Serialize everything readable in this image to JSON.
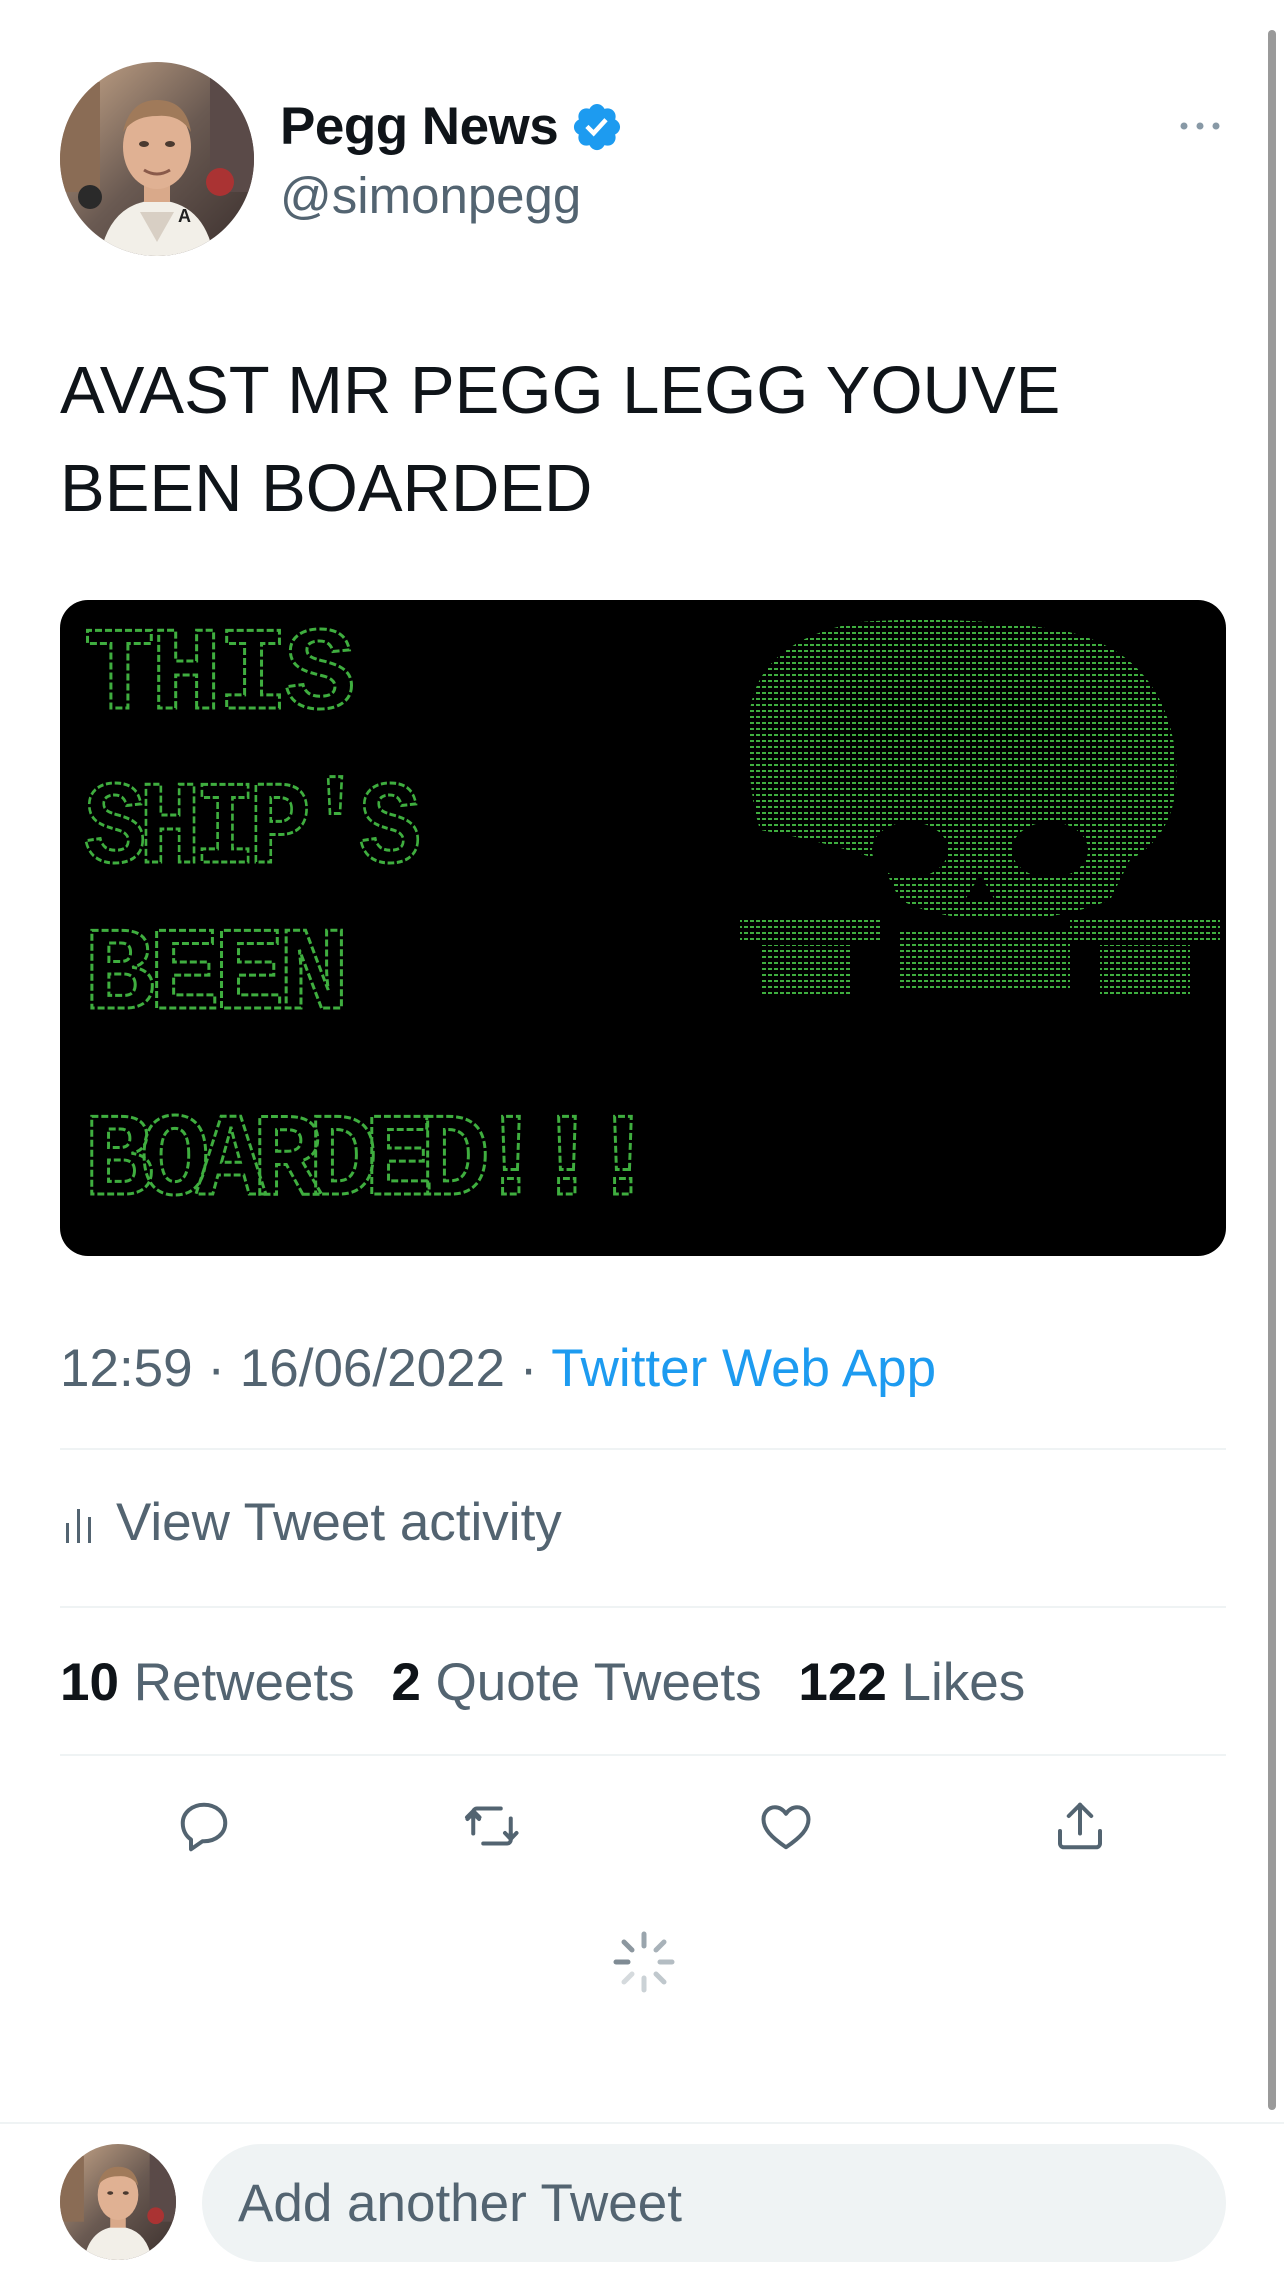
{
  "author": {
    "display_name": "Pegg News",
    "handle": "@simonpegg",
    "verified": true,
    "avatar_icon": "profile-photo"
  },
  "tweet": {
    "text": "AVAST MR PEGG LEGG YOUVE BEEN BOARDED",
    "media": {
      "banner_lines": [
        "THIS",
        "SHIP'S",
        "BEEN",
        "BOARDED!!!"
      ],
      "art_icon": "skull-crossbones-icon",
      "text_color": "#3fae3f",
      "background": "#000000"
    },
    "time": "12:59",
    "date": "16/06/2022",
    "source": "Twitter Web App",
    "separator": "·"
  },
  "activity": {
    "label": "View Tweet activity",
    "icon": "analytics-icon"
  },
  "stats": {
    "retweets_count": "10",
    "retweets_label": "Retweets",
    "quotes_count": "2",
    "quotes_label": "Quote Tweets",
    "likes_count": "122",
    "likes_label": "Likes"
  },
  "actions": [
    "reply-icon",
    "retweet-icon",
    "like-icon",
    "share-icon"
  ],
  "reply": {
    "placeholder": "Add another Tweet"
  },
  "colors": {
    "accent": "#1d9bf0",
    "secondary_text": "#536471",
    "primary_text": "#0f1419"
  }
}
